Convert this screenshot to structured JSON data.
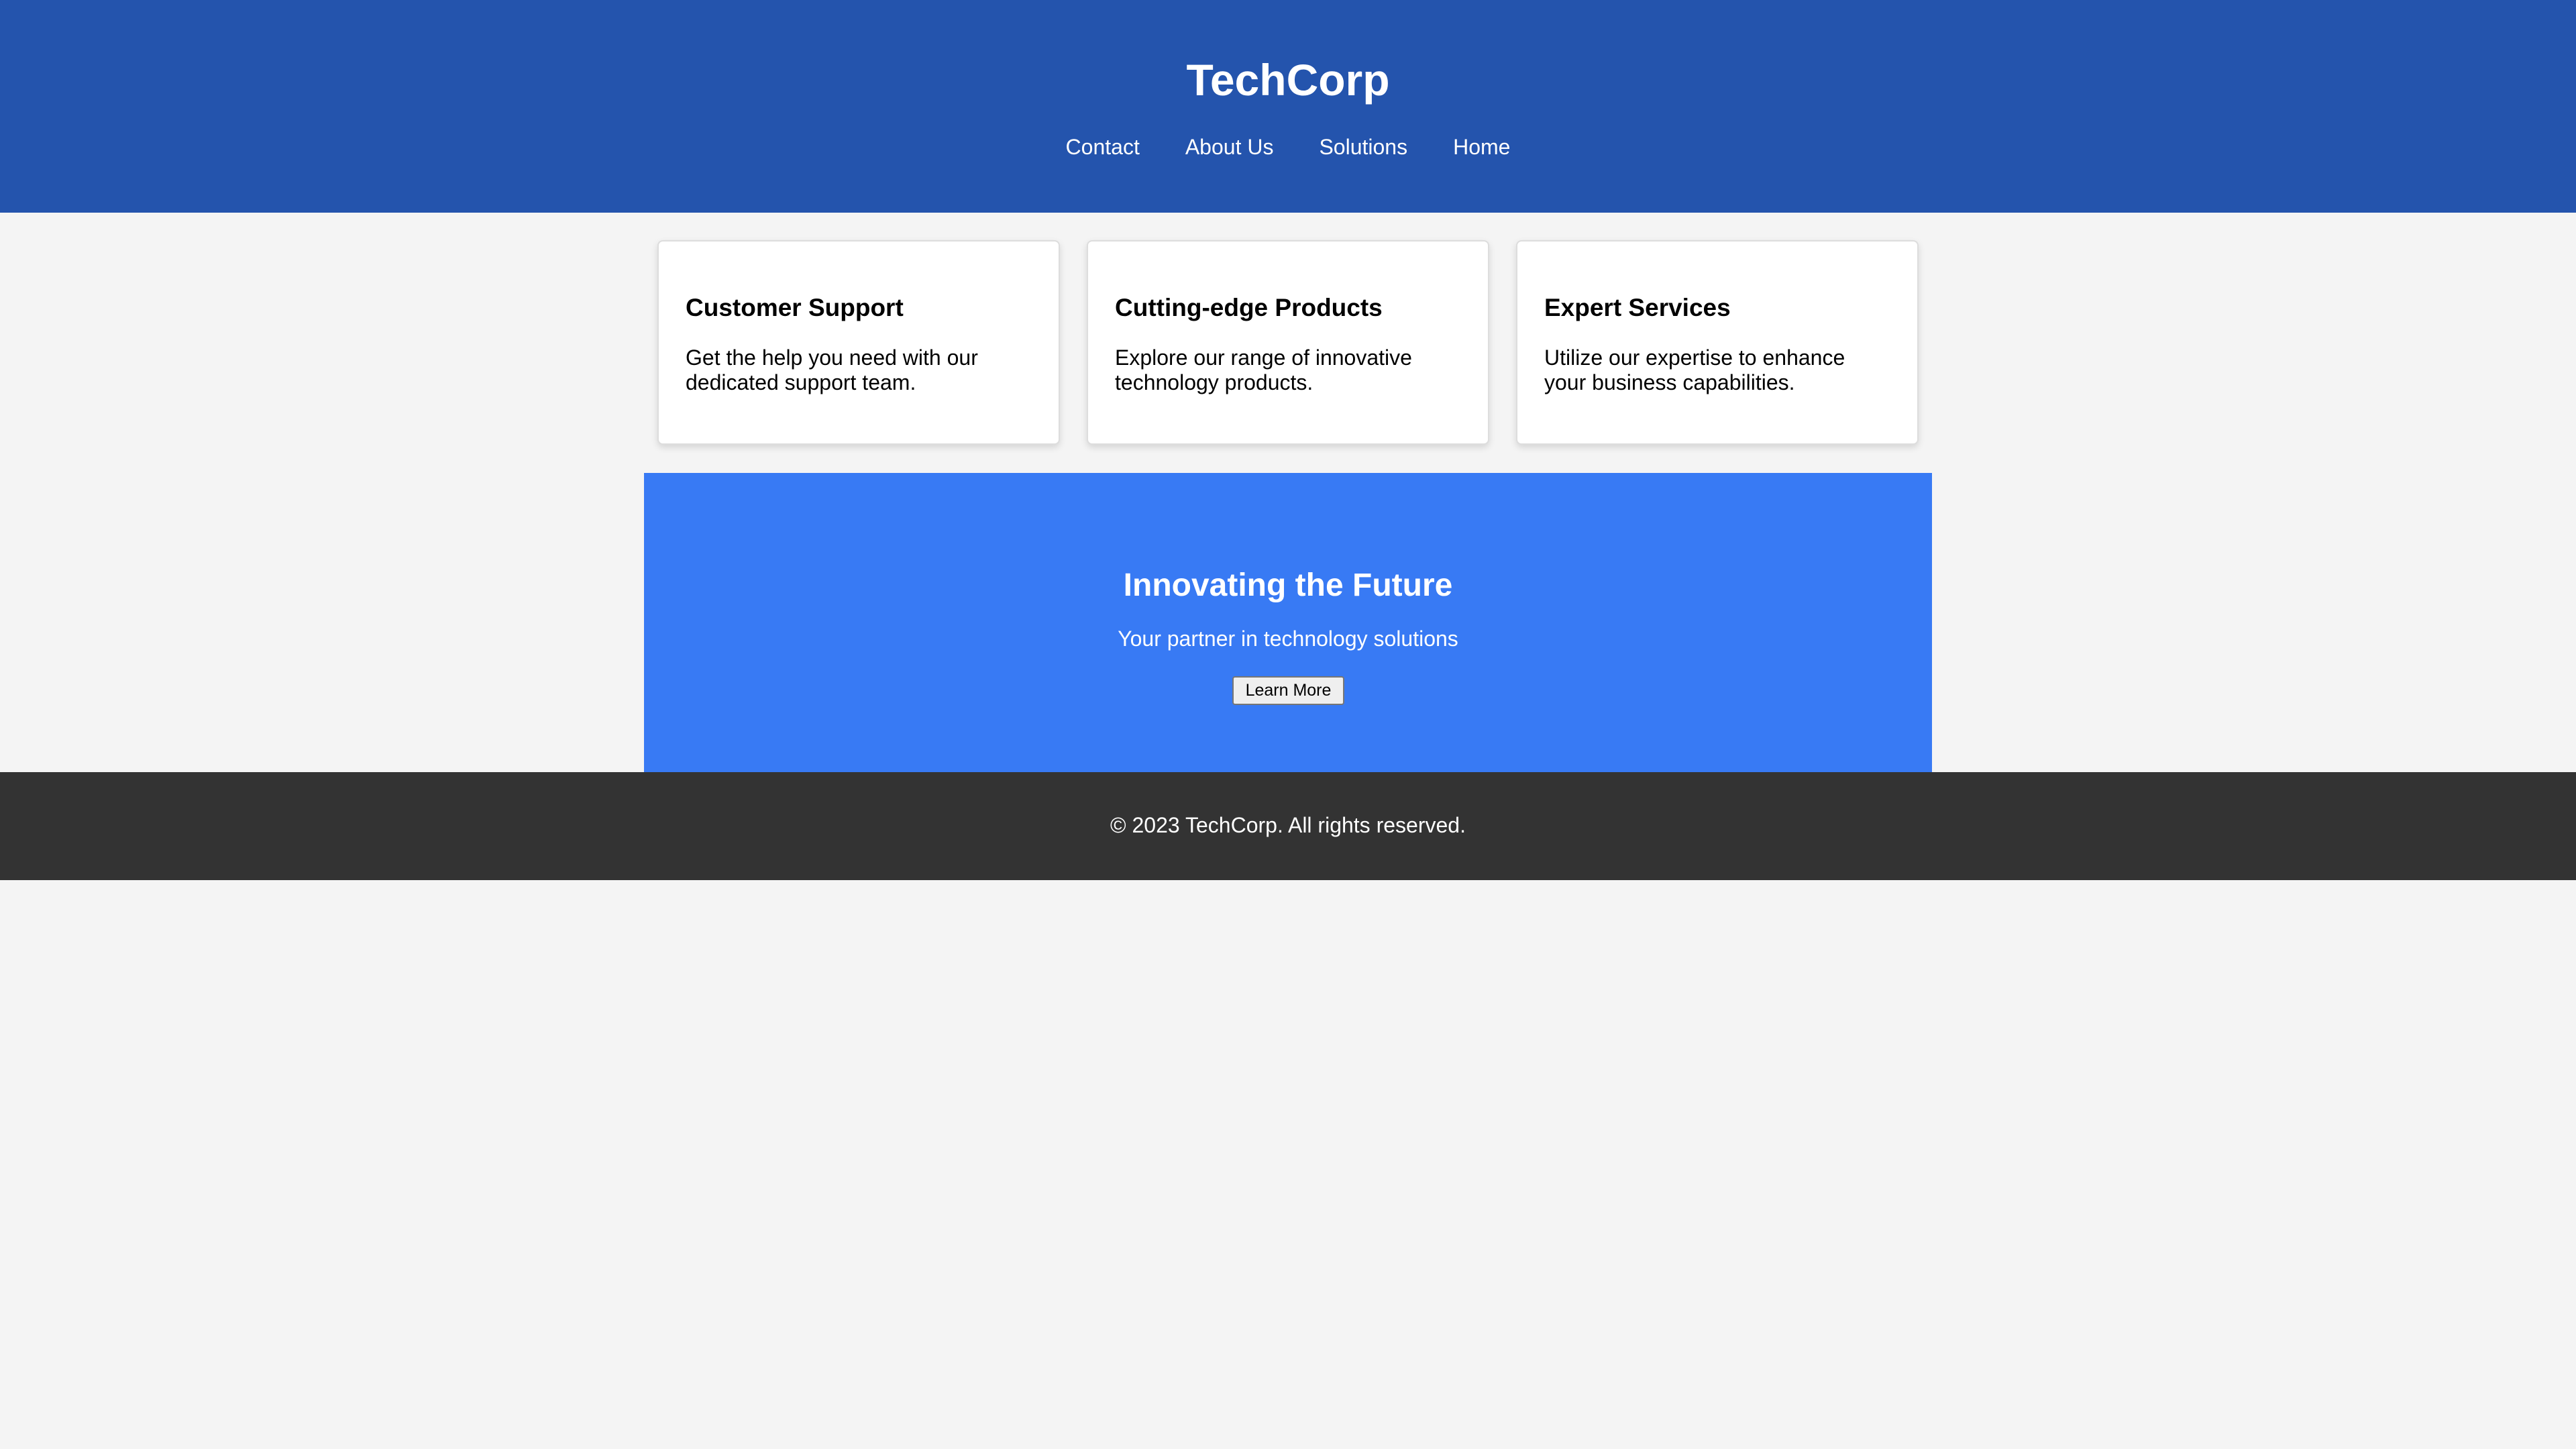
{
  "header": {
    "brand": "TechCorp",
    "nav": [
      {
        "label": "Contact"
      },
      {
        "label": "About Us"
      },
      {
        "label": "Solutions"
      },
      {
        "label": "Home"
      }
    ]
  },
  "cards": [
    {
      "title": "Customer Support",
      "text": "Get the help you need with our dedicated support team."
    },
    {
      "title": "Cutting-edge Products",
      "text": "Explore our range of innovative technology products."
    },
    {
      "title": "Expert Services",
      "text": "Utilize our expertise to enhance your business capabilities."
    }
  ],
  "hero": {
    "title": "Innovating the Future",
    "subtitle": "Your partner in technology solutions",
    "button_label": "Learn More"
  },
  "footer": {
    "text": "© 2023 TechCorp. All rights reserved."
  },
  "colors": {
    "header_bg": "#2454ad",
    "hero_bg": "#387af4",
    "footer_bg": "#333333",
    "page_bg": "#f4f4f4"
  }
}
